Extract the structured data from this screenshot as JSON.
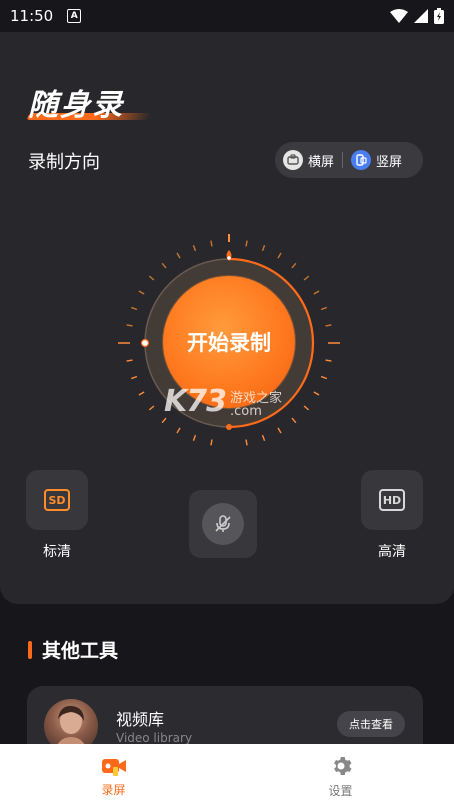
{
  "status_bar": {
    "time": "11:50",
    "notif_letter": "A"
  },
  "app": {
    "logo": "随身录"
  },
  "orientation": {
    "title": "录制方向",
    "landscape_label": "横屏",
    "portrait_label": "竖屏",
    "selected": "portrait"
  },
  "record": {
    "button_label": "开始录制"
  },
  "watermark": {
    "brand": "K73",
    "cn": "游戏之家",
    "domain": ".com"
  },
  "quality": {
    "sd_badge": "SD",
    "sd_label": "标清",
    "hd_badge": "HD",
    "hd_label": "高清"
  },
  "tools": {
    "section_title": "其他工具",
    "items": [
      {
        "name": "视频库",
        "subtitle": "Video library",
        "action": "点击查看"
      }
    ]
  },
  "nav": {
    "items": [
      {
        "label": "录屏",
        "active": true
      },
      {
        "label": "设置",
        "active": false
      }
    ]
  },
  "colors": {
    "accent": "#ff6a1a",
    "background": "#17171b",
    "card": "#28282c"
  }
}
